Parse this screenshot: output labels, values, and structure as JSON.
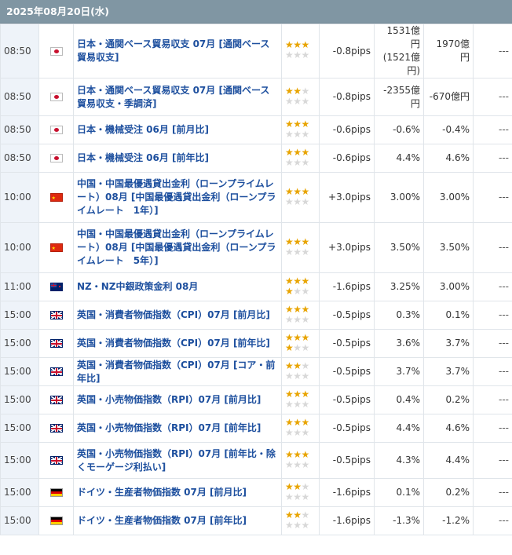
{
  "header": {
    "date": "2025年08月20日(水)"
  },
  "colors": {
    "header_bg": "#8096a3",
    "time_bg": "#eef3f9",
    "link": "#1d4f9e",
    "star_on": "#e8a400",
    "star_off": "#d8d8d8"
  },
  "rows": [
    {
      "time": "08:50",
      "flag": "jp-flag-icon",
      "country": "jp",
      "event": "日本・通関ベース貿易収支 07月 [通関ベース貿易収支]",
      "stars": 3,
      "pips": "-0.8pips",
      "prev": "1531億円\n(1521億円)",
      "forecast": "1970億円",
      "actual": "---"
    },
    {
      "time": "08:50",
      "flag": "jp-flag-icon",
      "country": "jp",
      "event": "日本・通関ベース貿易収支 07月 [通関ベース貿易収支・季調済]",
      "stars": 2,
      "pips": "-0.8pips",
      "prev": "-2355億円",
      "forecast": "-670億円",
      "actual": "---"
    },
    {
      "time": "08:50",
      "flag": "jp-flag-icon",
      "country": "jp",
      "event": "日本・機械受注 06月 [前月比]",
      "stars": 3,
      "pips": "-0.6pips",
      "prev": "-0.6%",
      "forecast": "-0.4%",
      "actual": "---"
    },
    {
      "time": "08:50",
      "flag": "jp-flag-icon",
      "country": "jp",
      "event": "日本・機械受注 06月 [前年比]",
      "stars": 3,
      "pips": "-0.6pips",
      "prev": "4.4%",
      "forecast": "4.6%",
      "actual": "---"
    },
    {
      "time": "10:00",
      "flag": "cn-flag-icon",
      "country": "cn",
      "event": "中国・中国最優遇貸出金利（ローンプライムレート）08月 [中国最優遇貸出金利（ローンプライムレート　1年）]",
      "stars": 3,
      "pips": "+3.0pips",
      "prev": "3.00%",
      "forecast": "3.00%",
      "actual": "---"
    },
    {
      "time": "10:00",
      "flag": "cn-flag-icon",
      "country": "cn",
      "event": "中国・中国最優遇貸出金利（ローンプライムレート）08月 [中国最優遇貸出金利（ローンプライムレート　5年）]",
      "stars": 3,
      "pips": "+3.0pips",
      "prev": "3.50%",
      "forecast": "3.50%",
      "actual": "---"
    },
    {
      "time": "11:00",
      "flag": "nz-flag-icon",
      "country": "nz",
      "event": "NZ・NZ中銀政策金利 08月",
      "stars": 4,
      "pips": "-1.6pips",
      "prev": "3.25%",
      "forecast": "3.00%",
      "actual": "---"
    },
    {
      "time": "15:00",
      "flag": "uk-flag-icon",
      "country": "uk",
      "event": "英国・消費者物価指数（CPI）07月 [前月比]",
      "stars": 3,
      "pips": "-0.5pips",
      "prev": "0.3%",
      "forecast": "0.1%",
      "actual": "---"
    },
    {
      "time": "15:00",
      "flag": "uk-flag-icon",
      "country": "uk",
      "event": "英国・消費者物価指数（CPI）07月 [前年比]",
      "stars": 4,
      "pips": "-0.5pips",
      "prev": "3.6%",
      "forecast": "3.7%",
      "actual": "---"
    },
    {
      "time": "15:00",
      "flag": "uk-flag-icon",
      "country": "uk",
      "event": "英国・消費者物価指数（CPI）07月 [コア・前年比]",
      "stars": 2,
      "pips": "-0.5pips",
      "prev": "3.7%",
      "forecast": "3.7%",
      "actual": "---"
    },
    {
      "time": "15:00",
      "flag": "uk-flag-icon",
      "country": "uk",
      "event": "英国・小売物価指数（RPI）07月 [前月比]",
      "stars": 3,
      "pips": "-0.5pips",
      "prev": "0.4%",
      "forecast": "0.2%",
      "actual": "---"
    },
    {
      "time": "15:00",
      "flag": "uk-flag-icon",
      "country": "uk",
      "event": "英国・小売物価指数（RPI）07月 [前年比]",
      "stars": 3,
      "pips": "-0.5pips",
      "prev": "4.4%",
      "forecast": "4.6%",
      "actual": "---"
    },
    {
      "time": "15:00",
      "flag": "uk-flag-icon",
      "country": "uk",
      "event": "英国・小売物価指数（RPI）07月 [前年比・除くモーゲージ利払い]",
      "stars": 3,
      "pips": "-0.5pips",
      "prev": "4.3%",
      "forecast": "4.4%",
      "actual": "---"
    },
    {
      "time": "15:00",
      "flag": "de-flag-icon",
      "country": "de",
      "event": "ドイツ・生産者物価指数 07月 [前月比]",
      "stars": 2,
      "pips": "-1.6pips",
      "prev": "0.1%",
      "forecast": "0.2%",
      "actual": "---"
    },
    {
      "time": "15:00",
      "flag": "de-flag-icon",
      "country": "de",
      "event": "ドイツ・生産者物価指数 07月 [前年比]",
      "stars": 2,
      "pips": "-1.6pips",
      "prev": "-1.3%",
      "forecast": "-1.2%",
      "actual": "---"
    }
  ]
}
